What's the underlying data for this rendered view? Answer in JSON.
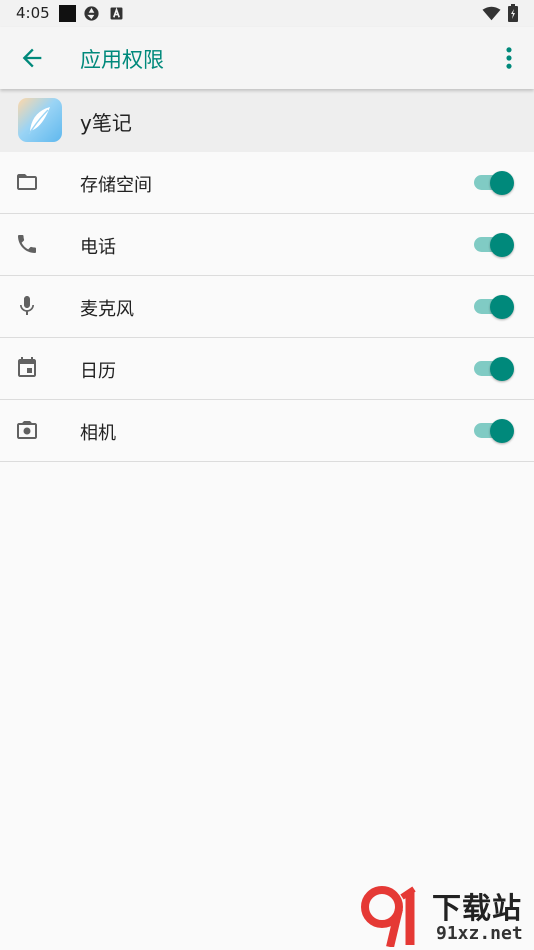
{
  "status_bar": {
    "time": "4:05",
    "icons": [
      "black-square-icon",
      "aperture-icon",
      "a-box-icon",
      "wifi-icon",
      "battery-icon"
    ]
  },
  "appbar": {
    "title": "应用权限",
    "back_icon": "arrow-back-icon",
    "more_icon": "more-vert-icon"
  },
  "app": {
    "name": "y笔记",
    "icon": "feather-app-icon"
  },
  "permissions": [
    {
      "label": "存储空间",
      "icon": "folder-icon",
      "enabled": true
    },
    {
      "label": "电话",
      "icon": "phone-icon",
      "enabled": true
    },
    {
      "label": "麦克风",
      "icon": "mic-icon",
      "enabled": true
    },
    {
      "label": "日历",
      "icon": "calendar-icon",
      "enabled": true
    },
    {
      "label": "相机",
      "icon": "camera-icon",
      "enabled": true
    }
  ],
  "watermark": {
    "brand": "下载站",
    "url": "91xz.net"
  },
  "colors": {
    "accent": "#00897b",
    "track": "#80cbc4",
    "watermark_red": "#e53935"
  }
}
